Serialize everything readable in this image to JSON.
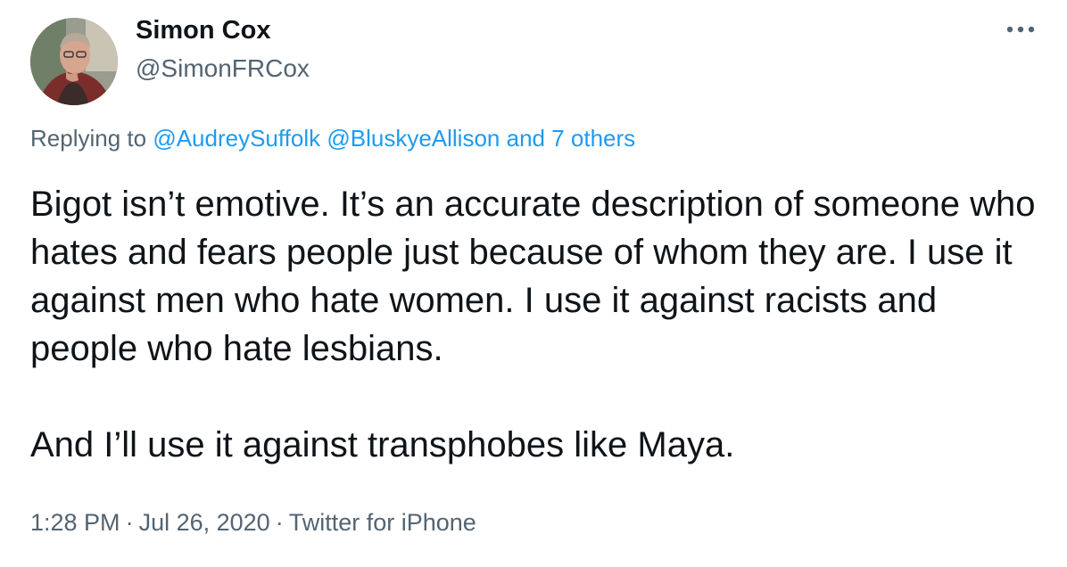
{
  "tweet": {
    "author": {
      "display_name": "Simon Cox",
      "handle": "@SimonFRCox",
      "avatar_icon": "profile-photo"
    },
    "more_icon": "more-horizontal-icon",
    "reply": {
      "prefix": "Replying to",
      "mentions": [
        "@AudreySuffolk",
        "@BluskyeAllison"
      ],
      "others": "and 7 others"
    },
    "text": {
      "paragraphs": [
        "Bigot isn’t emotive. It’s an accurate description of someone who hates and fears people just because of whom they are. I use it against men who hate women. I use it against racists and people who hate lesbians.",
        "And I’ll use it against transphobes like Maya."
      ]
    },
    "meta": {
      "time": "1:28 PM",
      "separator": "·",
      "date": "Jul 26, 2020",
      "source": "Twitter for iPhone"
    },
    "colors": {
      "text": "#0f1419",
      "secondary": "#536471",
      "link": "#1d9bf0",
      "background": "#ffffff"
    }
  }
}
